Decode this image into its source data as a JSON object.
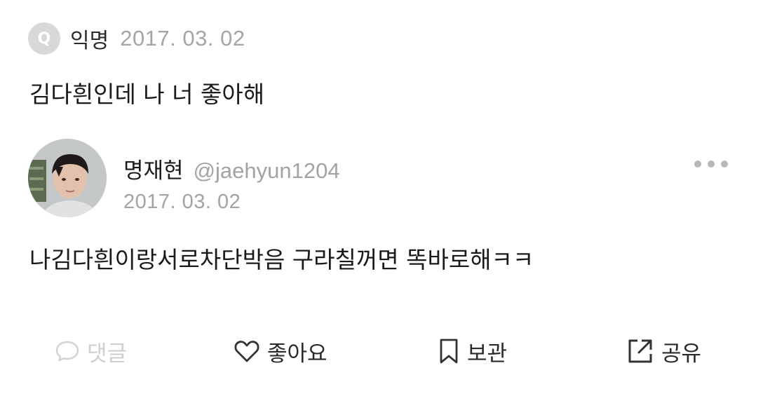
{
  "question": {
    "badge": "Q",
    "author": "익명",
    "date": "2017. 03. 02",
    "text": "김다흰인데 나 너 좋아해"
  },
  "answer": {
    "name": "명재현",
    "handle": "@jaehyun1204",
    "date": "2017. 03. 02",
    "text": "나김다흰이랑서로차단박음 구라칠꺼면 똑바로해ㅋㅋ"
  },
  "actions": {
    "comment": "댓글",
    "like": "좋아요",
    "save": "보관",
    "share": "공유"
  },
  "icons": {
    "more": "more-dots-icon",
    "comment": "comment-bubble-icon",
    "like": "heart-icon",
    "save": "bookmark-icon",
    "share": "share-external-icon"
  },
  "colors": {
    "muted_text": "#a5a5a5",
    "disabled_action": "#cfcfcf",
    "icon_gray": "#b8b8b8"
  }
}
